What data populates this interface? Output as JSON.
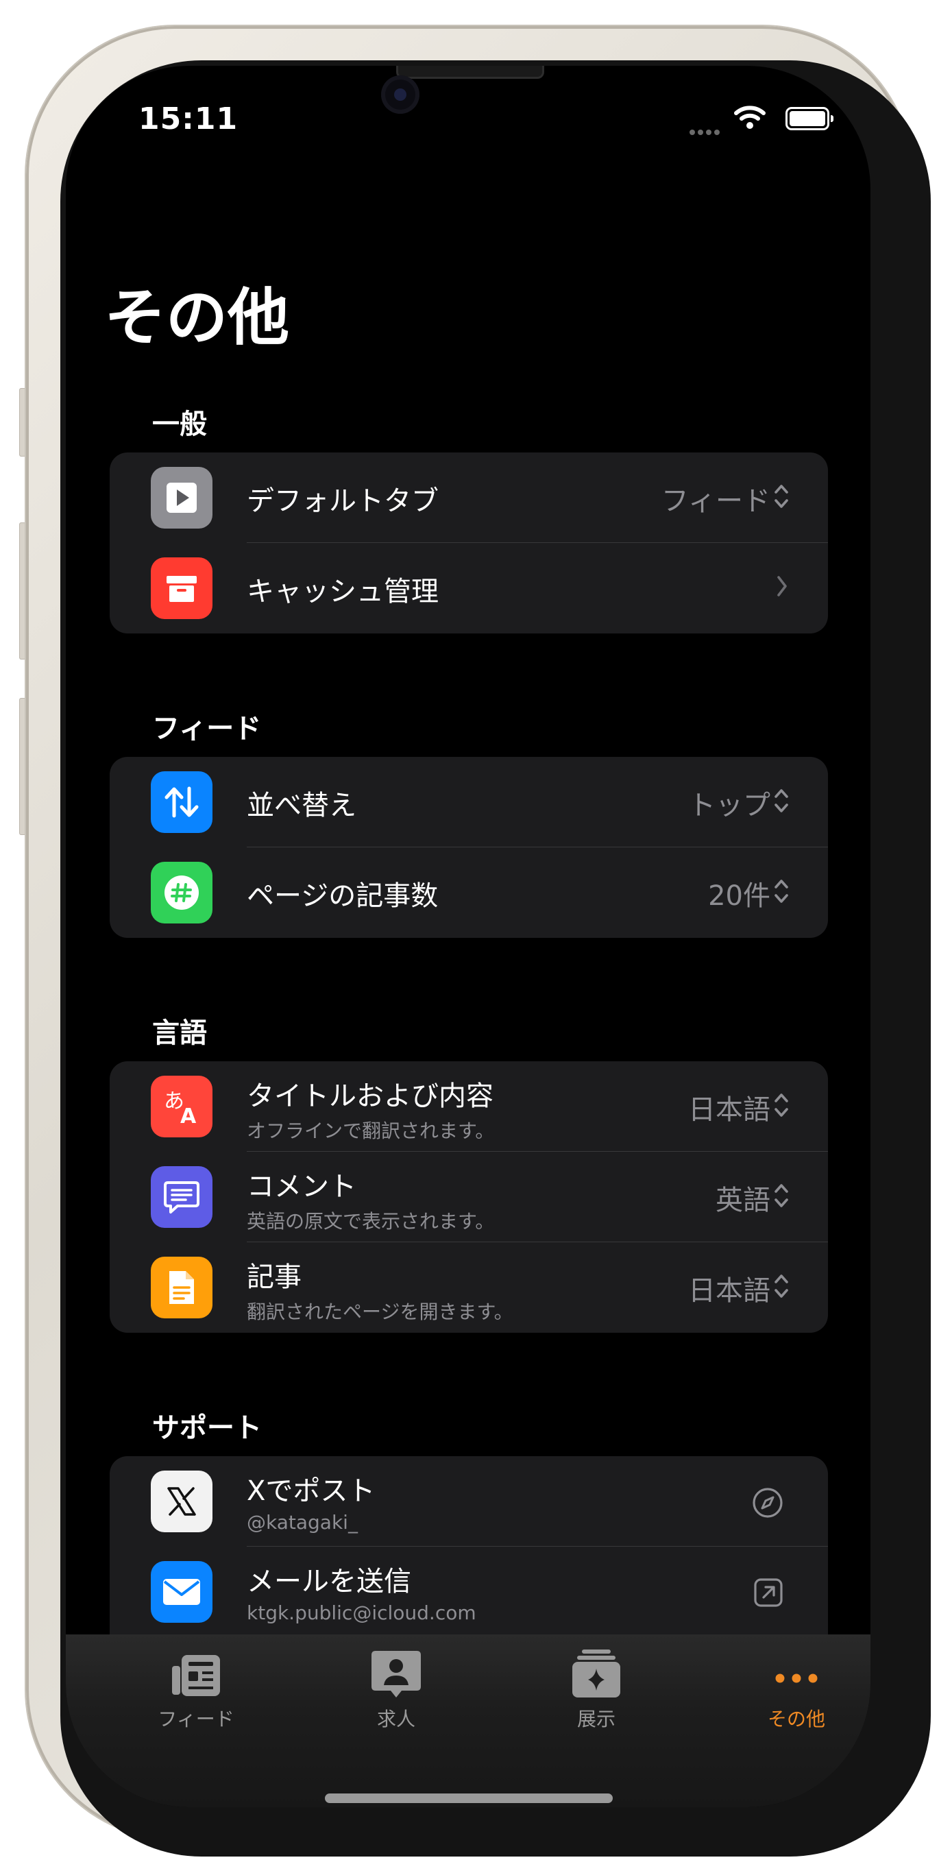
{
  "status_bar": {
    "time": "15:11"
  },
  "page": {
    "title": "その他"
  },
  "sections": {
    "general": {
      "header": "一般",
      "rows": [
        {
          "label": "デフォルトタブ",
          "value": "フィード",
          "icon": "play-icon",
          "icon_color": "#8e8e93"
        },
        {
          "label": "キャッシュ管理",
          "icon": "archive-box-icon",
          "icon_color": "#ff3b30"
        }
      ]
    },
    "feed": {
      "header": "フィード",
      "rows": [
        {
          "label": "並べ替え",
          "value": "トップ",
          "icon": "sort-arrows-icon",
          "icon_color": "#0a84ff"
        },
        {
          "label": "ページの記事数",
          "value": "20件",
          "icon": "number-sign-icon",
          "icon_color": "#30d158"
        }
      ]
    },
    "language": {
      "header": "言語",
      "rows": [
        {
          "label": "タイトルおよび内容",
          "subtitle": "オフラインで翻訳されます。",
          "value": "日本語",
          "icon": "translate-icon",
          "icon_color": "#ff453a"
        },
        {
          "label": "コメント",
          "subtitle": "英語の原文で表示されます。",
          "value": "英語",
          "icon": "comment-bubble-icon",
          "icon_color": "#5e5ce6"
        },
        {
          "label": "記事",
          "subtitle": "翻訳されたページを開きます。",
          "value": "日本語",
          "icon": "document-icon",
          "icon_color": "#ff9f0a"
        }
      ]
    },
    "support": {
      "header": "サポート",
      "rows": [
        {
          "label": "Xでポスト",
          "subtitle": "@katagaki_",
          "icon": "x-logo-icon",
          "icon_color": "#f2f2f2"
        },
        {
          "label": "メールを送信",
          "subtitle": "ktgk.public@icloud.com",
          "icon": "envelope-icon",
          "icon_color": "#0a84ff"
        }
      ]
    }
  },
  "tabbar": {
    "items": [
      {
        "label": "フィード",
        "icon": "newspaper-icon"
      },
      {
        "label": "求人",
        "icon": "person-card-icon"
      },
      {
        "label": "展示",
        "icon": "sparkle-stack-icon"
      },
      {
        "label": "その他",
        "icon": "ellipsis-icon",
        "active": true
      }
    ],
    "active_color": "#f08a24"
  }
}
